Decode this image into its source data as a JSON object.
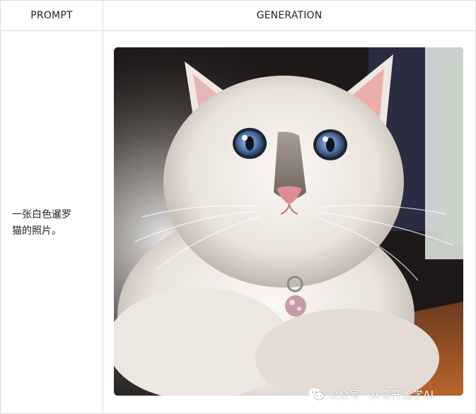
{
  "table": {
    "headers": {
      "prompt": "PROMPT",
      "generation": "GENERATION"
    },
    "rows": [
      {
        "prompt_line1": "一张白色暹罗",
        "prompt_line2": "猫的照片。"
      }
    ]
  },
  "image": {
    "icon": "generated-cat-photo"
  },
  "watermark": {
    "icon": "wechat-icon",
    "text": "公众号 · 从零开始学AI"
  },
  "colors": {
    "border": "#dcdcdc",
    "text": "#222222"
  }
}
